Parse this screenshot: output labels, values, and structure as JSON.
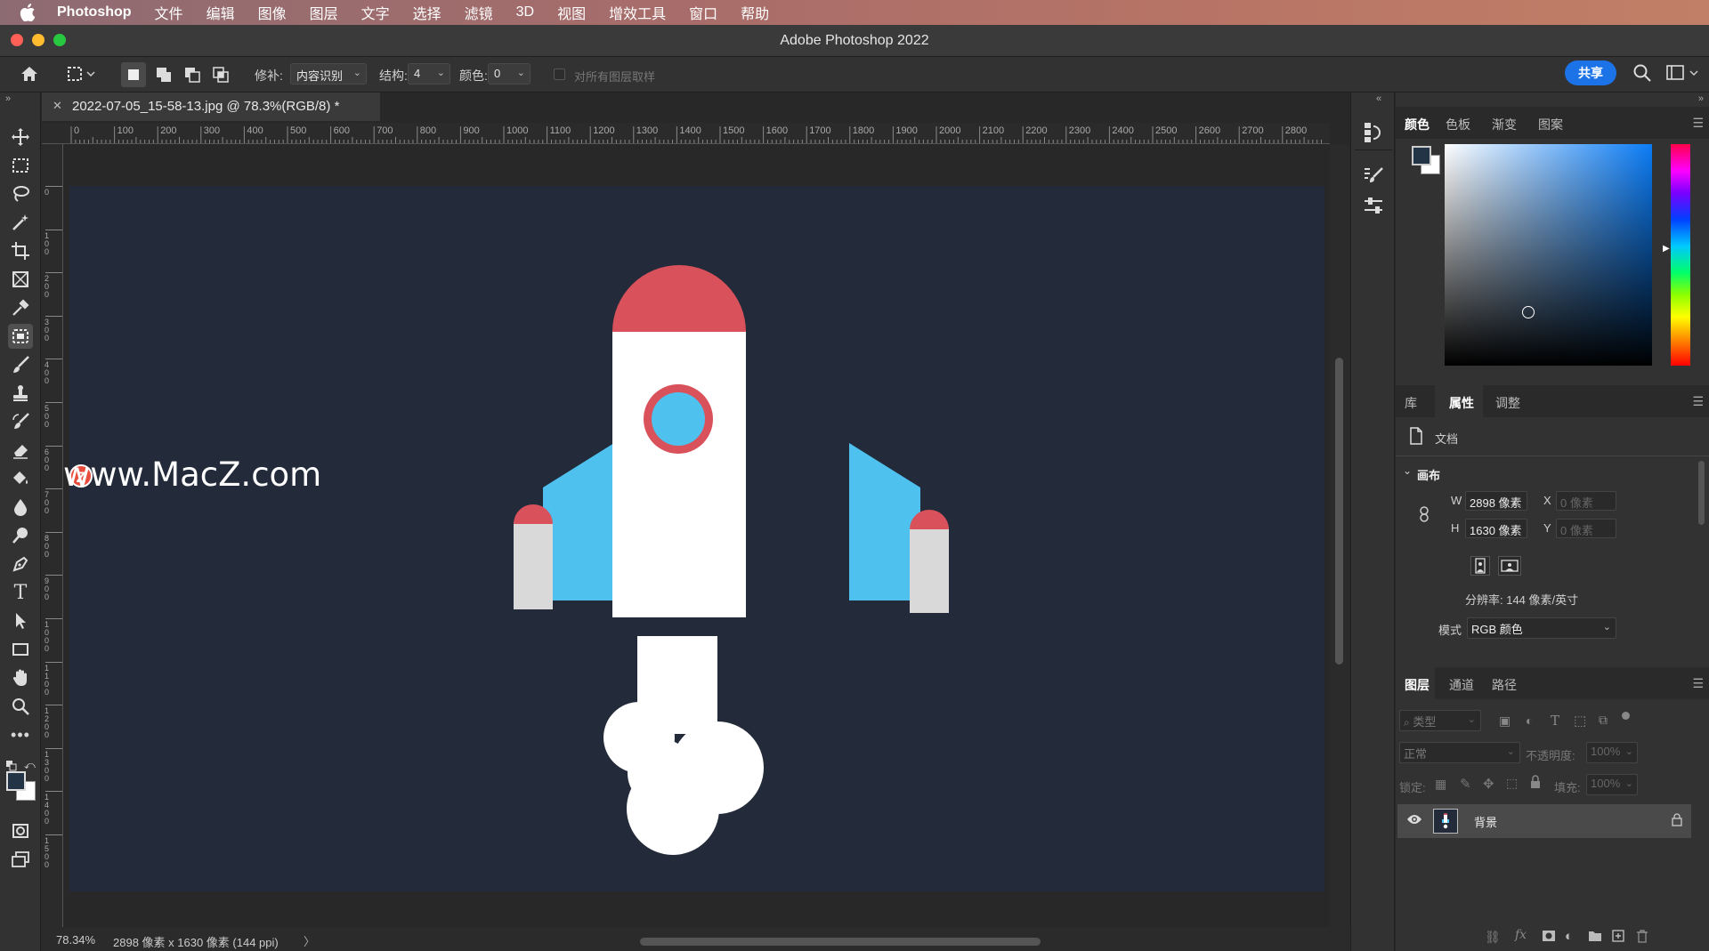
{
  "menubar": {
    "app_name": "Photoshop",
    "items": [
      "文件",
      "编辑",
      "图像",
      "图层",
      "文字",
      "选择",
      "滤镜",
      "3D",
      "视图",
      "增效工具",
      "窗口",
      "帮助"
    ]
  },
  "window": {
    "title": "Adobe Photoshop 2022"
  },
  "options_bar": {
    "patch_label": "修补:",
    "patch_value": "内容识别",
    "structure_label": "结构:",
    "structure_value": "4",
    "color_label": "颜色:",
    "color_value": "0",
    "sample_all_label": "对所有图层取样",
    "share_label": "共享"
  },
  "document": {
    "tab_title": "2022-07-05_15-58-13.jpg @ 78.3%(RGB/8) *",
    "ruler_ticks": [
      "0",
      "100",
      "200",
      "300",
      "400",
      "500",
      "600",
      "700",
      "800",
      "900",
      "1000",
      "1100",
      "1200",
      "1300",
      "1400",
      "1500",
      "1600",
      "1700",
      "1800",
      "1900",
      "2000",
      "2100",
      "2200",
      "2300",
      "2400",
      "2500",
      "2600",
      "2700",
      "2800"
    ],
    "vruler_ticks": [
      "0",
      "100",
      "200",
      "300",
      "400",
      "500",
      "600",
      "700",
      "800",
      "900",
      "1000",
      "1100",
      "1200",
      "1300",
      "1400",
      "1500"
    ],
    "watermark": "www.MacZ.com",
    "watermark_logo_letter": "Z",
    "canvas_bg": "#232b3a"
  },
  "status_bar": {
    "zoom": "78.34%",
    "info": "2898 像素 x 1630 像素 (144 ppi)",
    "arrow": "〉"
  },
  "color_panel": {
    "tabs": [
      "颜色",
      "色板",
      "渐变",
      "图案"
    ],
    "active_tab": "颜色",
    "foreground": "#243447",
    "background": "#ffffff"
  },
  "properties_panel": {
    "tabs": [
      "库",
      "属性",
      "调整"
    ],
    "active_tab": "属性",
    "doc_label": "文档",
    "canvas_section": "画布",
    "w_label": "W",
    "w_value": "2898 像素",
    "h_label": "H",
    "h_value": "1630 像素",
    "x_label": "X",
    "x_placeholder": "0 像素",
    "y_label": "Y",
    "y_placeholder": "0 像素",
    "resolution": "分辨率: 144 像素/英寸",
    "mode_label": "模式",
    "mode_value": "RGB 颜色"
  },
  "layers_panel": {
    "tabs": [
      "图层",
      "通道",
      "路径"
    ],
    "active_tab": "图层",
    "filter_placeholder": "类型",
    "blend_mode": "正常",
    "opacity_label": "不透明度:",
    "opacity_value": "100%",
    "lock_label": "锁定:",
    "fill_label": "填充:",
    "fill_value": "100%",
    "layers": [
      {
        "name": "背景",
        "visible": true,
        "locked": true
      }
    ]
  }
}
